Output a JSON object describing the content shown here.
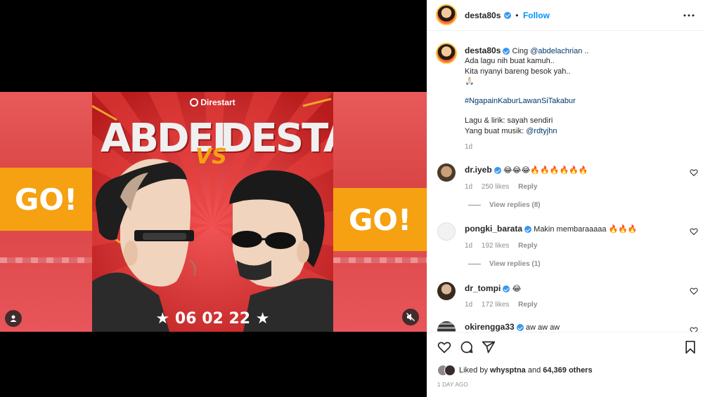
{
  "post": {
    "poster": {
      "brand": "Direstart",
      "left_name": "ABDEL",
      "vs": "VS",
      "right_name": "DESTA",
      "date": "★ 06 02 22 ★"
    },
    "go_text": "GO!"
  },
  "header": {
    "username": "desta80s",
    "dot": "•",
    "follow_label": "Follow",
    "more_icon": "more-horizontal-icon"
  },
  "caption": {
    "username": "desta80s",
    "line1_text": "Cing",
    "line1_mention": "@abdelachrian",
    "line1_tail": "..",
    "line2": "Ada lagu nih buat kamuh..",
    "line3": "Kita nyanyi bareng besok yah..",
    "line4": "🙏🏻",
    "hashtag": "#NgapainKaburLawanSiTakabur",
    "line5": "Lagu & lirik: sayah sendiri",
    "line6_text": "Yang buat musik:",
    "line6_mention": "@rdtyjhn",
    "time": "1d"
  },
  "comments": [
    {
      "username": "dr.iyeb",
      "text": "😂😂😂🔥🔥🔥🔥🔥🔥",
      "time": "1d",
      "likes": "250 likes",
      "reply": "Reply",
      "view_replies": "View replies (8)"
    },
    {
      "username": "pongki_barata",
      "text": "Makin membaraaaaa 🔥🔥🔥",
      "time": "1d",
      "likes": "192 likes",
      "reply": "Reply",
      "view_replies": "View replies (1)"
    },
    {
      "username": "dr_tompi",
      "text": "😂",
      "time": "1d",
      "likes": "172 likes",
      "reply": "Reply"
    },
    {
      "username": "okirengga33",
      "text": "aw aw aw"
    }
  ],
  "actions": {
    "like_icon": "heart-icon",
    "comment_icon": "comment-icon",
    "share_icon": "send-icon",
    "save_icon": "bookmark-icon"
  },
  "likes": {
    "prefix": "Liked by",
    "user": "whysptna",
    "mid": "and",
    "others": "64,369 others"
  },
  "timestamp": "1 DAY AGO",
  "colors": {
    "accent": "#0095f6",
    "poster_red": "#d52a2a",
    "go_orange": "#f5a111"
  }
}
